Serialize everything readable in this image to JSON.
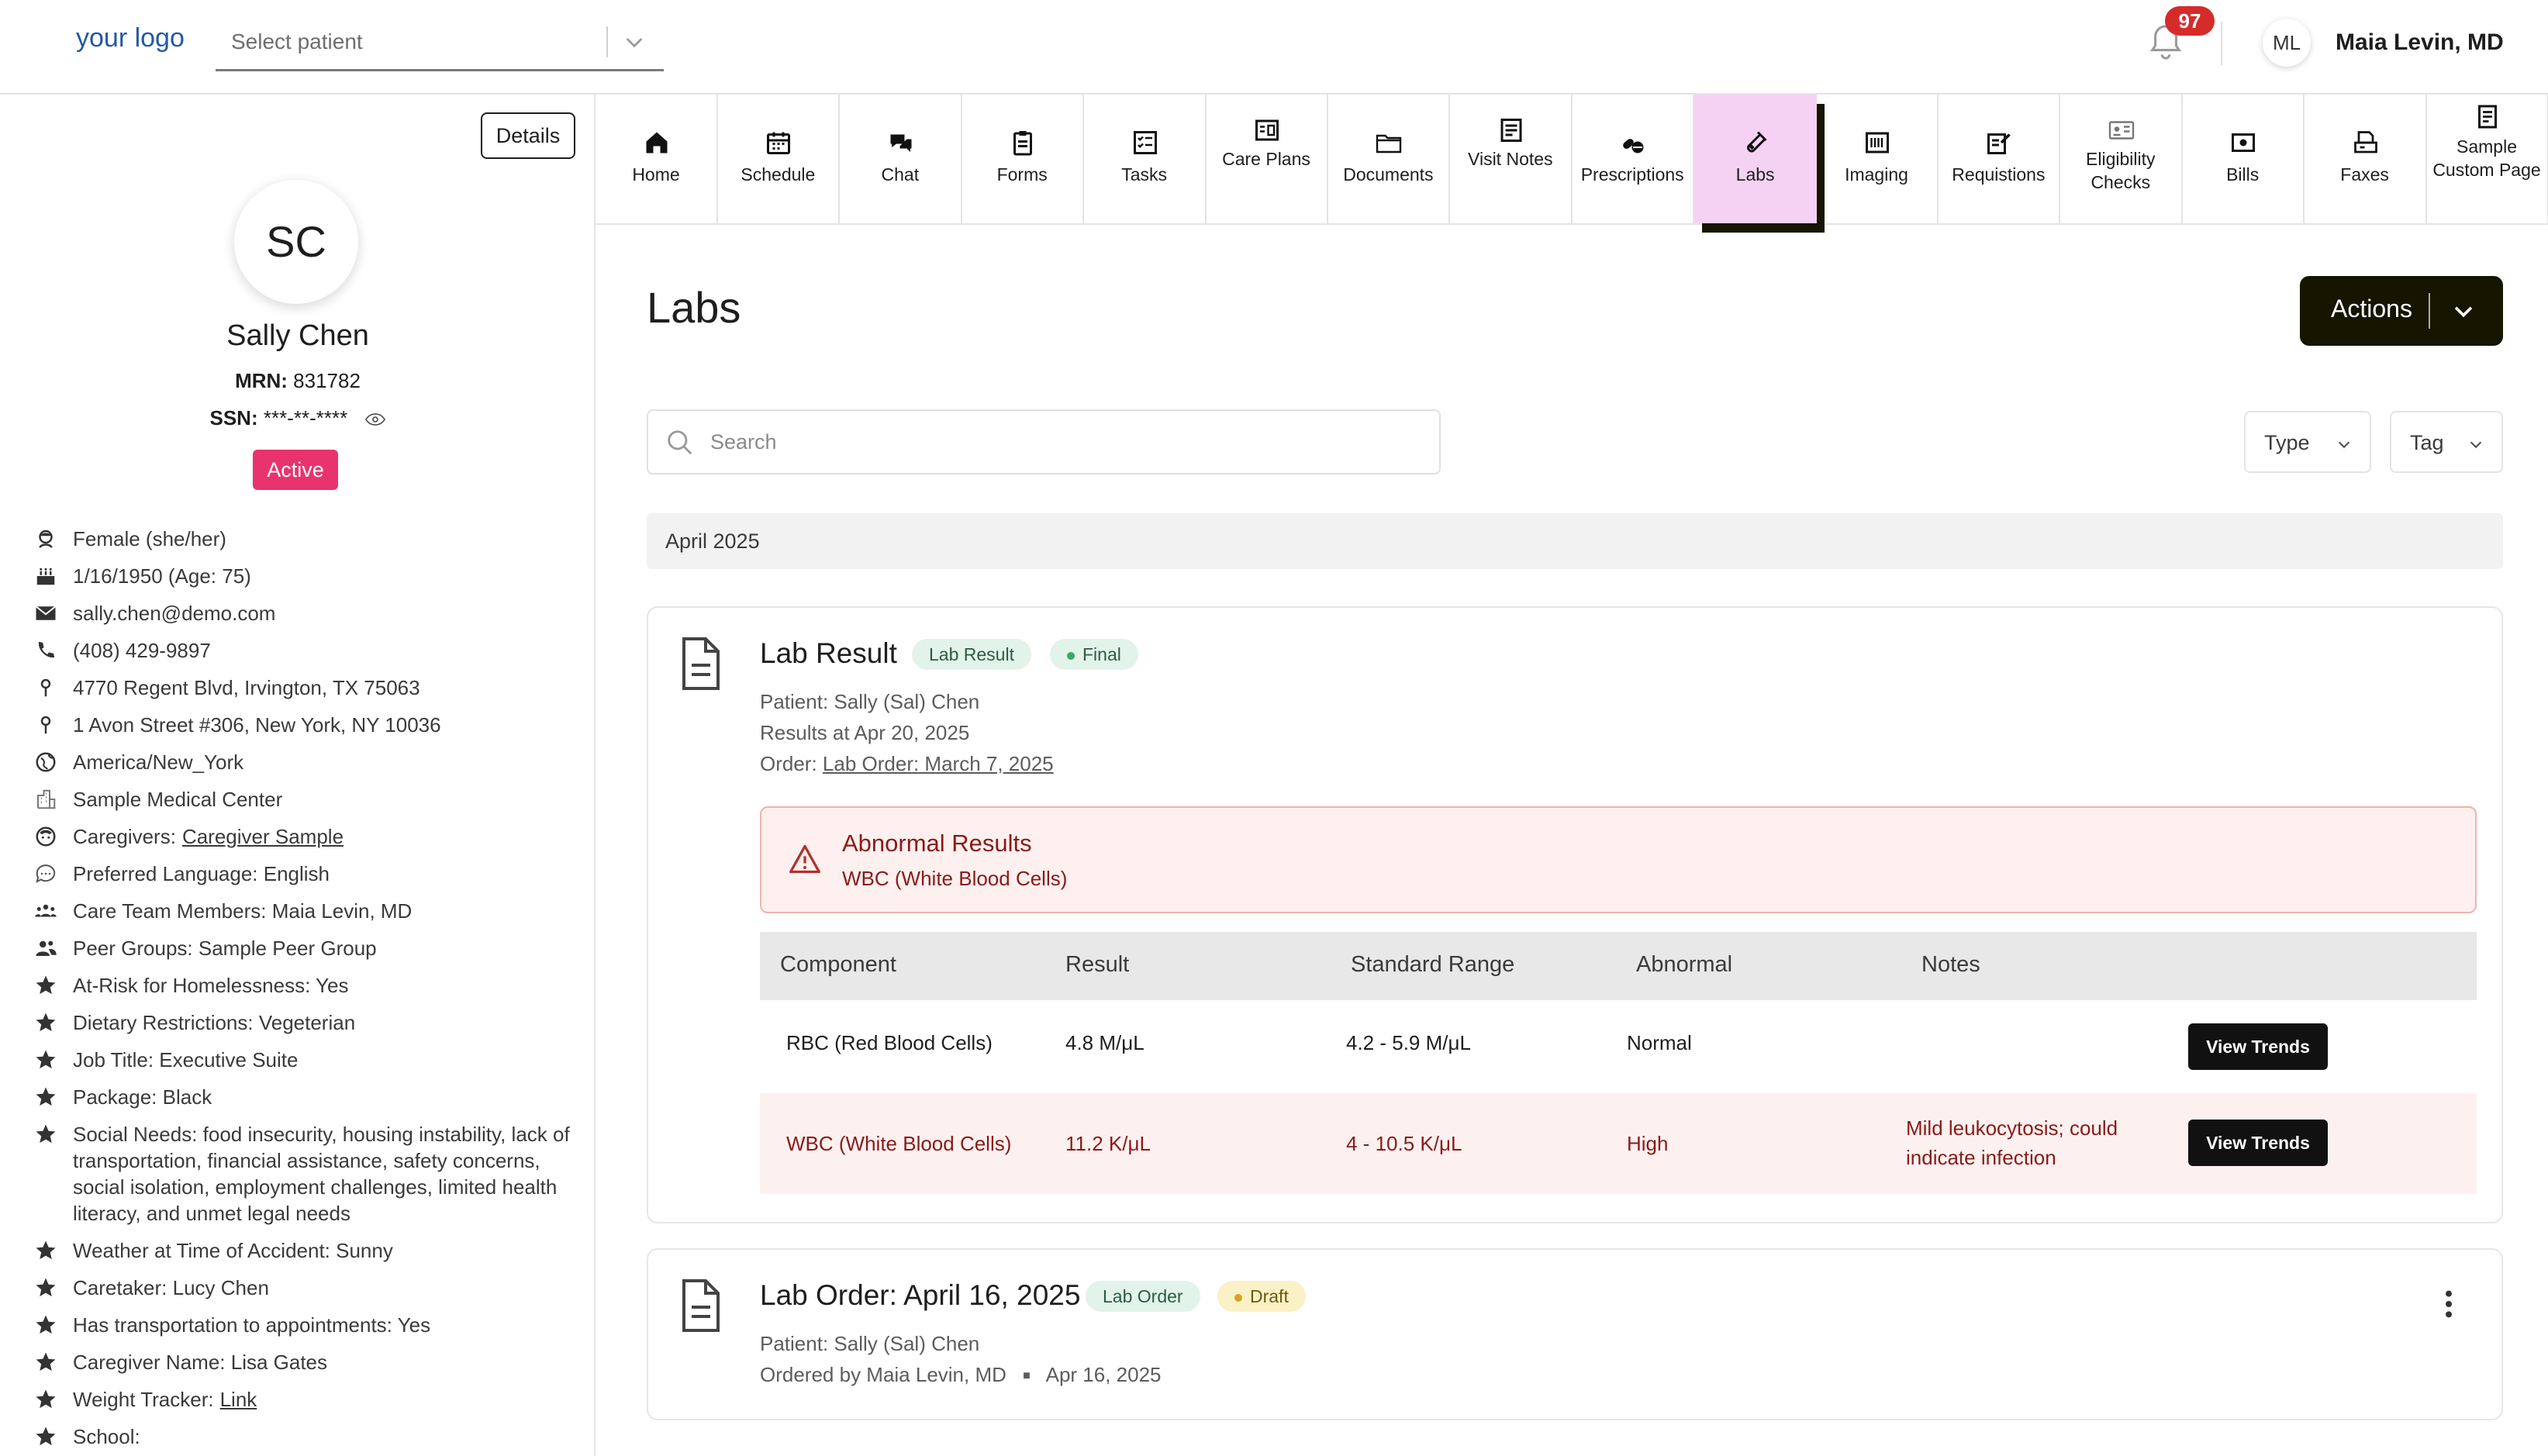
{
  "header": {
    "logo": "your logo",
    "patient_select_placeholder": "Select patient",
    "notification_count": "97",
    "user_initials": "ML",
    "user_name": "Maia Levin, MD"
  },
  "patient": {
    "details_label": "Details",
    "initials": "SC",
    "name": "Sally Chen",
    "mrn_label": "MRN:",
    "mrn": "831782",
    "ssn_label": "SSN:",
    "ssn": "***-**-****",
    "status": "Active",
    "attributes": [
      {
        "icon": "gender-icon",
        "text": "Female (she/her)"
      },
      {
        "icon": "birthday-cake-icon",
        "text": "1/16/1950 (Age: 75)"
      },
      {
        "icon": "email-icon",
        "text": "sally.chen@demo.com"
      },
      {
        "icon": "phone-icon",
        "text": "(408) 429-9897"
      },
      {
        "icon": "location-pin-icon",
        "text": "4770 Regent Blvd, Irvington, TX 75063"
      },
      {
        "icon": "location-pin-icon",
        "text": "1 Avon Street #306, New York, NY 10036"
      },
      {
        "icon": "globe-icon",
        "text": "America/New_York"
      },
      {
        "icon": "building-icon",
        "text": "Sample Medical Center"
      },
      {
        "icon": "caregiver-icon",
        "label": "Caregivers:",
        "link": "Caregiver Sample"
      },
      {
        "icon": "speech-bubble-icon",
        "text": "Preferred Language: English"
      },
      {
        "icon": "team-icon",
        "text": "Care Team Members: Maia Levin, MD"
      },
      {
        "icon": "group-icon",
        "text": "Peer Groups: Sample Peer Group"
      },
      {
        "icon": "star-icon",
        "text": "At-Risk for Homelessness: Yes"
      },
      {
        "icon": "star-icon",
        "text": "Dietary Restrictions: Vegeterian"
      },
      {
        "icon": "star-icon",
        "text": "Job Title: Executive Suite"
      },
      {
        "icon": "star-icon",
        "text": "Package: Black"
      },
      {
        "icon": "star-icon",
        "text": "Social Needs: food insecurity, housing instability, lack of transportation, financial assistance, safety concerns, social isolation, employment challenges, limited health literacy, and unmet legal needs"
      },
      {
        "icon": "star-icon",
        "text": "Weather at Time of Accident: Sunny"
      },
      {
        "icon": "star-icon",
        "text": "Caretaker: Lucy Chen"
      },
      {
        "icon": "star-icon",
        "text": "Has transportation to appointments: Yes"
      },
      {
        "icon": "star-icon",
        "text": "Caregiver Name: Lisa Gates"
      },
      {
        "icon": "star-icon",
        "label": "Weight Tracker:",
        "link": "Link"
      },
      {
        "icon": "star-icon",
        "text": "School:"
      }
    ]
  },
  "nav": {
    "tabs": [
      {
        "label": "Home",
        "icon": "home-icon"
      },
      {
        "label": "Schedule",
        "icon": "calendar-icon"
      },
      {
        "label": "Chat",
        "icon": "chat-icon"
      },
      {
        "label": "Forms",
        "icon": "clipboard-icon"
      },
      {
        "label": "Tasks",
        "icon": "checklist-icon"
      },
      {
        "label": "Care Plans",
        "icon": "care-plan-icon"
      },
      {
        "label": "Documents",
        "icon": "folder-icon"
      },
      {
        "label": "Visit Notes",
        "icon": "notes-icon"
      },
      {
        "label": "Prescriptions",
        "icon": "pills-icon"
      },
      {
        "label": "Labs",
        "icon": "test-tube-icon",
        "active": true
      },
      {
        "label": "Imaging",
        "icon": "imaging-icon"
      },
      {
        "label": "Requistions",
        "icon": "requisition-icon"
      },
      {
        "label": "Eligibility Checks",
        "icon": "id-card-icon"
      },
      {
        "label": "Bills",
        "icon": "bill-icon"
      },
      {
        "label": "Faxes",
        "icon": "fax-icon"
      },
      {
        "label": "Sample Custom Page",
        "icon": "page-icon"
      }
    ]
  },
  "main": {
    "title": "Labs",
    "actions_label": "Actions",
    "search_placeholder": "Search",
    "filters": {
      "type": "Type",
      "tag": "Tag"
    },
    "month": "April 2025",
    "lab_result": {
      "title": "Lab Result",
      "tag": "Lab Result",
      "status": "Final",
      "patient": "Patient: Sally (Sal) Chen",
      "results_at": "Results at Apr 20, 2025",
      "order_label": "Order:",
      "order_link": "Lab Order: March 7, 2025",
      "alert_title": "Abnormal Results",
      "alert_detail": "WBC (White Blood Cells)",
      "columns": [
        "Component",
        "Result",
        "Standard Range",
        "Abnormal",
        "Notes"
      ],
      "rows": [
        {
          "component": "RBC (Red Blood Cells)",
          "result": "4.8 M/μL",
          "range": "4.2 - 5.9 M/μL",
          "abnormal": "Normal",
          "notes": "",
          "button": "View Trends"
        },
        {
          "component": "WBC (White Blood Cells)",
          "result": "11.2 K/μL",
          "range": "4 - 10.5 K/μL",
          "abnormal": "High",
          "notes": "Mild leukocytosis; could indicate infection",
          "button": "View Trends"
        }
      ]
    },
    "lab_order": {
      "title": "Lab Order: April 16, 2025",
      "tag": "Lab Order",
      "status": "Draft",
      "patient": "Patient: Sally (Sal) Chen",
      "ordered_by": "Ordered by Maia Levin, MD",
      "date": "Apr 16, 2025"
    }
  },
  "colors": {
    "active_tab": "#f5d2f3",
    "status_active": "#e8336e",
    "abnormal_text": "#8a1a1a",
    "notification_badge": "#d62b2b",
    "primary_dark": "#151500"
  }
}
